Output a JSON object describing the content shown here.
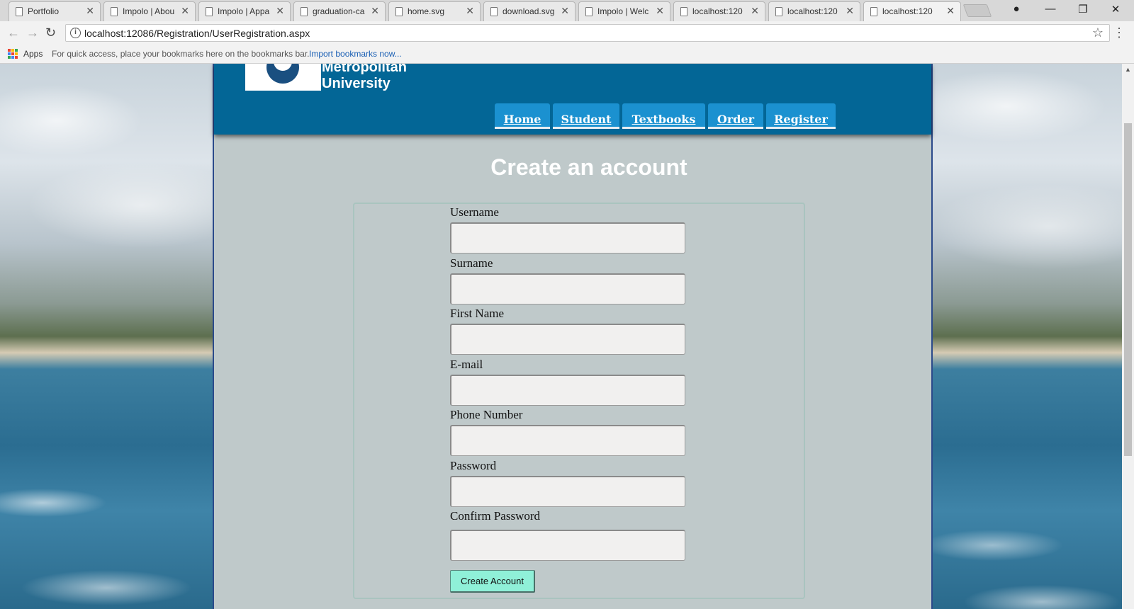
{
  "browser": {
    "tabs": [
      {
        "title": "Portfolio"
      },
      {
        "title": "Impolo | Abou"
      },
      {
        "title": "Impolo | Appa"
      },
      {
        "title": "graduation-ca"
      },
      {
        "title": "home.svg"
      },
      {
        "title": "download.svg"
      },
      {
        "title": "Impolo | Welc"
      },
      {
        "title": "localhost:120"
      },
      {
        "title": "localhost:120"
      },
      {
        "title": "localhost:120"
      }
    ],
    "close_glyph": "✕",
    "url": "localhost:12086/Registration/UserRegistration.aspx",
    "bookmarks": {
      "apps_label": "Apps",
      "hint": "For quick access, place your bookmarks here on the bookmarks bar.",
      "import_link": "Import bookmarks now..."
    }
  },
  "site": {
    "university_name_line1": "Metropolitan",
    "university_name_line2": "University",
    "nav": [
      "Home",
      "Student",
      "Textbooks",
      "Order",
      "Register"
    ],
    "page_title": "Create an account",
    "form": {
      "fields": [
        {
          "label": "Username",
          "value": ""
        },
        {
          "label": "Surname",
          "value": ""
        },
        {
          "label": "First Name",
          "value": ""
        },
        {
          "label": "E-mail",
          "value": ""
        },
        {
          "label": "Phone Number",
          "value": ""
        },
        {
          "label": "Password",
          "value": ""
        },
        {
          "label": "Confirm Password",
          "value": ""
        }
      ],
      "submit_label": "Create Account"
    }
  },
  "colors": {
    "header_blue": "#036696",
    "nav_blue": "#1b91d0",
    "content_bg": "#bfc9ca",
    "button_mint": "#8ff0d8"
  }
}
